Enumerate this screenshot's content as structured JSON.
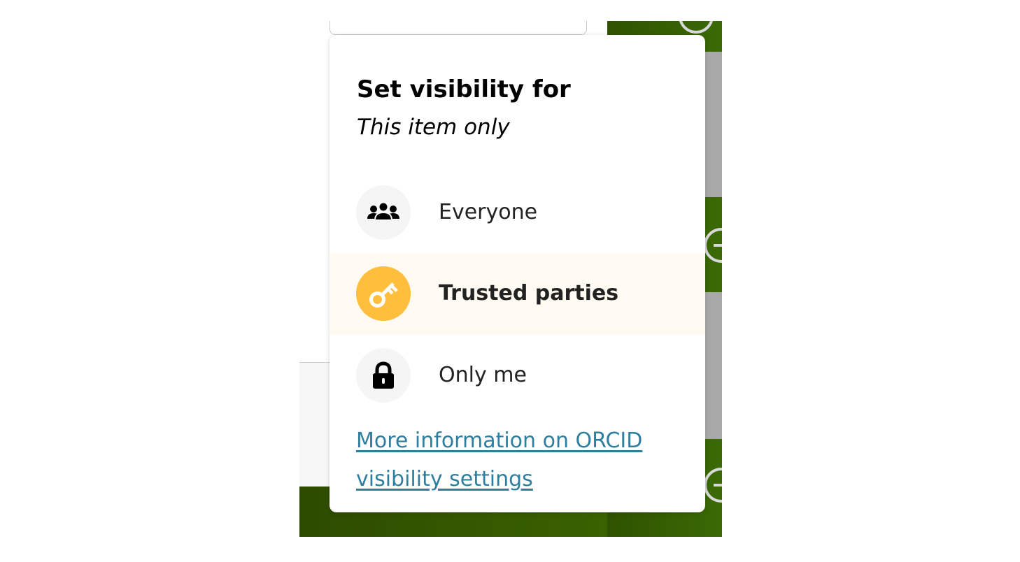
{
  "popover": {
    "title": "Set visibility for",
    "subtitle": "This item only",
    "options": [
      {
        "label": "Everyone",
        "icon": "everyone-icon",
        "selected": false
      },
      {
        "label": "Trusted parties",
        "icon": "key-icon",
        "selected": true
      },
      {
        "label": "Only me",
        "icon": "lock-icon",
        "selected": false
      }
    ],
    "info_link": "More information on ORCID visibility settings"
  },
  "colors": {
    "accent": "#ffbf3c",
    "selected_row_bg": "#fffbf2",
    "link": "#2e7f9f",
    "background_green": "#3b6a05"
  }
}
